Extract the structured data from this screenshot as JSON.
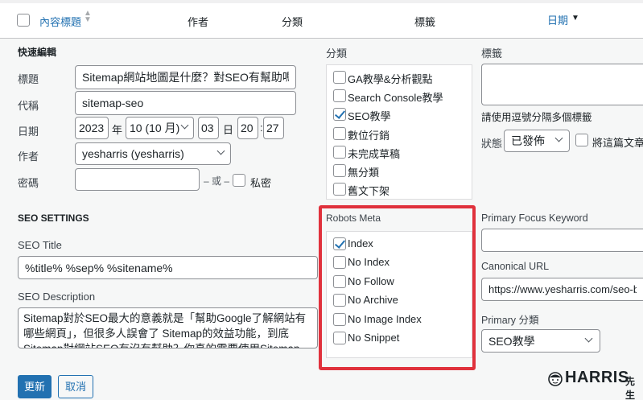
{
  "header": {
    "col_title": "內容標題",
    "col_author": "作者",
    "col_category": "分類",
    "col_tags": "標籤",
    "col_date": "日期"
  },
  "quick_edit": {
    "heading": "快速編輯",
    "title_label": "標題",
    "title_value": "Sitemap網站地圖是什麼？對SEO有幫助嗎？",
    "slug_label": "代稱",
    "slug_value": "sitemap-seo",
    "date_label": "日期",
    "year": "2023",
    "year_unit": "年",
    "month": "10 (10 月)",
    "day": "03",
    "day_unit": "日",
    "hour": "20",
    "time_sep": ":",
    "minute": "27",
    "author_label": "作者",
    "author_value": "yesharris (yesharris)",
    "password_label": "密碼",
    "password_value": "",
    "or_text": "– 或 –",
    "private_label": "私密"
  },
  "categories": {
    "heading": "分類",
    "items": [
      {
        "label": "GA教學&分析觀點",
        "checked": false
      },
      {
        "label": "Search Console教學",
        "checked": false
      },
      {
        "label": "SEO教學",
        "checked": true
      },
      {
        "label": "數位行銷",
        "checked": false
      },
      {
        "label": "未完成草稿",
        "checked": false
      },
      {
        "label": "無分類",
        "checked": false
      },
      {
        "label": "舊文下架",
        "checked": false
      }
    ]
  },
  "tags": {
    "heading": "標籤",
    "hint": "請使用逗號分隔多個標籤",
    "status_label": "狀態",
    "status_value": "已發佈",
    "sticky_label": "將這篇文章置"
  },
  "seo": {
    "heading": "SEO SETTINGS",
    "title_label": "SEO Title",
    "title_value": "%title% %sep% %sitename%",
    "desc_label": "SEO Description",
    "desc_value": "Sitemap對於SEO最大的意義就是「幫助Google了解網站有哪些網頁」，但很多人誤會了 Sitemap的效益功能，到底Sitemap對網站SEO有沒有幫助？你真的需要使用Sitemap嗎？"
  },
  "robots": {
    "heading": "Robots Meta",
    "highlight_color": "#e0313c",
    "items": [
      {
        "label": "Index",
        "checked": true
      },
      {
        "label": "No Index",
        "checked": false
      },
      {
        "label": "No Follow",
        "checked": false
      },
      {
        "label": "No Archive",
        "checked": false
      },
      {
        "label": "No Image Index",
        "checked": false
      },
      {
        "label": "No Snippet",
        "checked": false
      }
    ]
  },
  "right": {
    "focus_label": "Primary Focus Keyword",
    "focus_value": "",
    "canonical_label": "Canonical URL",
    "canonical_value": "https://www.yesharris.com/seo-b",
    "primary_cat_label": "Primary 分類",
    "primary_cat_value": "SEO教學"
  },
  "actions": {
    "update": "更新",
    "cancel": "取消"
  },
  "watermark": {
    "brand": "HARRIS",
    "suffix": "先生"
  }
}
